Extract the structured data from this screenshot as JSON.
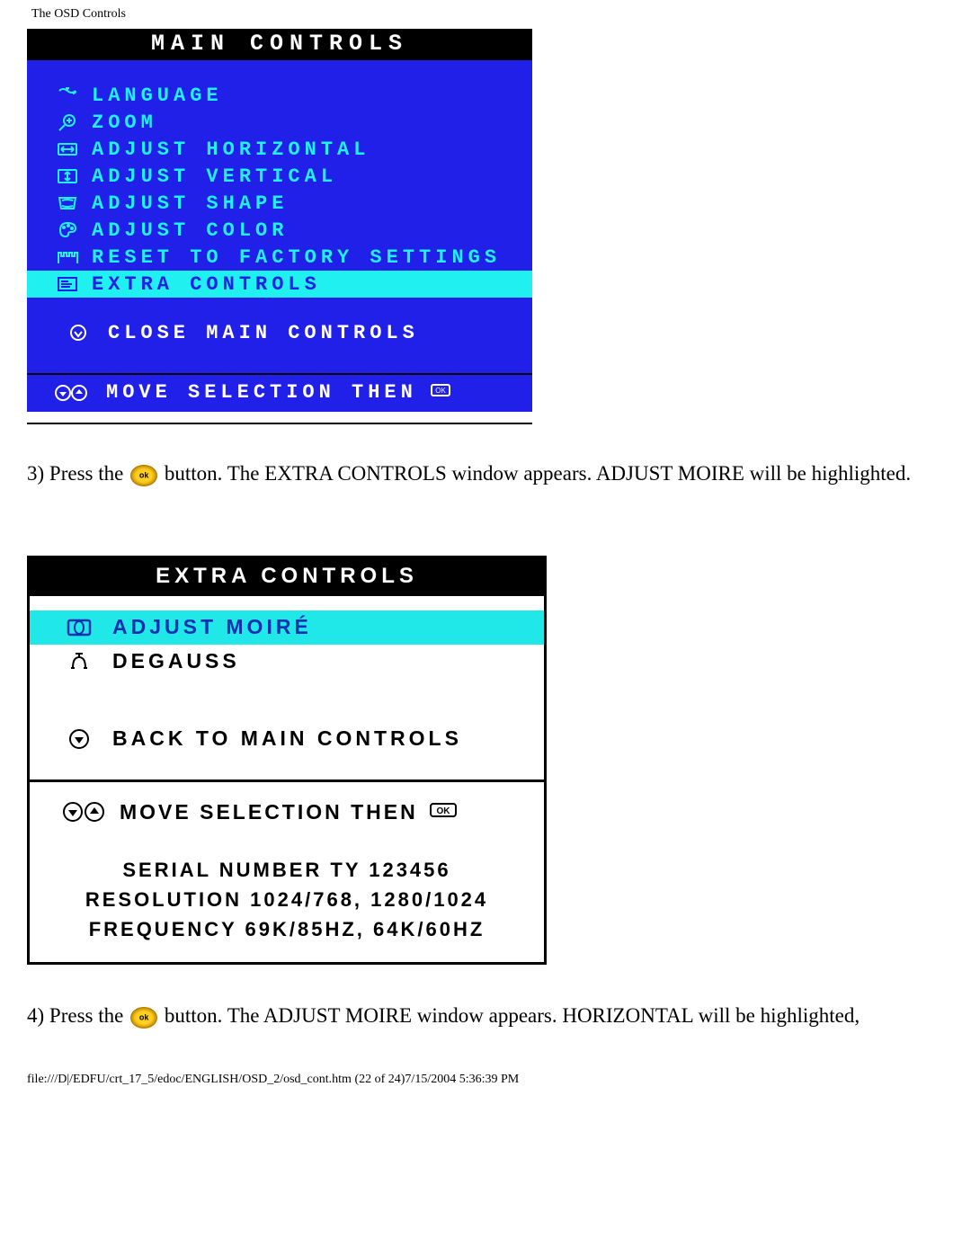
{
  "page": {
    "header": "The OSD Controls",
    "footer": "file:///D|/EDFU/crt_17_5/edoc/ENGLISH/OSD_2/osd_cont.htm (22 of 24)7/15/2004 5:36:39 PM"
  },
  "main_controls": {
    "title": "MAIN CONTROLS",
    "items": [
      {
        "label": "LANGUAGE",
        "icon": "language-icon",
        "selected": false
      },
      {
        "label": "ZOOM",
        "icon": "zoom-icon",
        "selected": false
      },
      {
        "label": "ADJUST HORIZONTAL",
        "icon": "adjust-horizontal-icon",
        "selected": false
      },
      {
        "label": "ADJUST VERTICAL",
        "icon": "adjust-vertical-icon",
        "selected": false
      },
      {
        "label": "ADJUST SHAPE",
        "icon": "adjust-shape-icon",
        "selected": false
      },
      {
        "label": "ADJUST COLOR",
        "icon": "adjust-color-icon",
        "selected": false
      },
      {
        "label": "RESET TO FACTORY SETTINGS",
        "icon": "reset-icon",
        "selected": false
      },
      {
        "label": "EXTRA CONTROLS",
        "icon": "extra-controls-icon",
        "selected": true
      }
    ],
    "close_label": "CLOSE MAIN CONTROLS",
    "hint_label": "MOVE SELECTION THEN"
  },
  "instruction_3": {
    "prefix": "3) Press the ",
    "suffix": " button. The EXTRA CONTROLS window appears. ADJUST MOIRE will be highlighted."
  },
  "extra_controls": {
    "title": "EXTRA CONTROLS",
    "items": [
      {
        "label": "ADJUST MOIRÉ",
        "icon": "moire-icon",
        "selected": true
      },
      {
        "label": "DEGAUSS",
        "icon": "degauss-icon",
        "selected": false
      }
    ],
    "back_label": "BACK TO MAIN CONTROLS",
    "hint_label": "MOVE SELECTION THEN",
    "info": {
      "serial": "SERIAL NUMBER TY 123456",
      "resolution": "RESOLUTION 1024/768, 1280/1024",
      "frequency": "FREQUENCY 69K/85HZ, 64K/60HZ"
    }
  },
  "instruction_4": {
    "prefix": "4) Press the ",
    "suffix": " button. The ADJUST MOIRE window appears. HORIZONTAL will be highlighted,"
  }
}
